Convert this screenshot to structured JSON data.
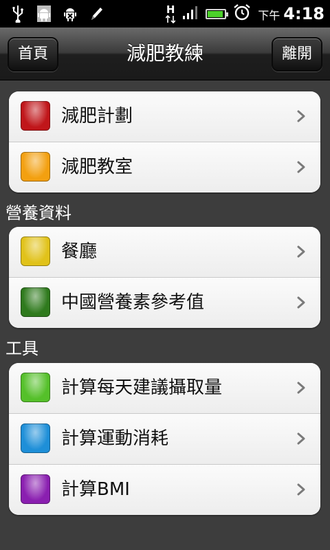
{
  "status_bar": {
    "time_prefix": "下午",
    "time": "4:18",
    "network_letter": "H",
    "battery_level": 0.9,
    "icons": [
      "usb-icon",
      "android-icon",
      "android-debug-icon",
      "pencil-icon",
      "hspa-icon",
      "signal-icon",
      "battery-icon",
      "alarm-icon"
    ]
  },
  "titlebar": {
    "title": "減肥教練",
    "left_button": "首頁",
    "right_button": "離開"
  },
  "groups": [
    {
      "header": "",
      "items": [
        {
          "label": "減肥計劃",
          "color": "#c0161a"
        },
        {
          "label": "減肥教室",
          "color": "#f3a010"
        }
      ]
    },
    {
      "header": "營養資料",
      "items": [
        {
          "label": "餐廳",
          "color": "#e1c21a"
        },
        {
          "label": "中國營養素參考值",
          "color": "#2f7a1d"
        }
      ]
    },
    {
      "header": "工具",
      "items": [
        {
          "label": "計算每天建議攝取量",
          "color": "#55c02a"
        },
        {
          "label": "計算運動消耗",
          "color": "#1e8fd8"
        },
        {
          "label": "計算BMI",
          "color": "#8a1fb0"
        }
      ]
    }
  ]
}
